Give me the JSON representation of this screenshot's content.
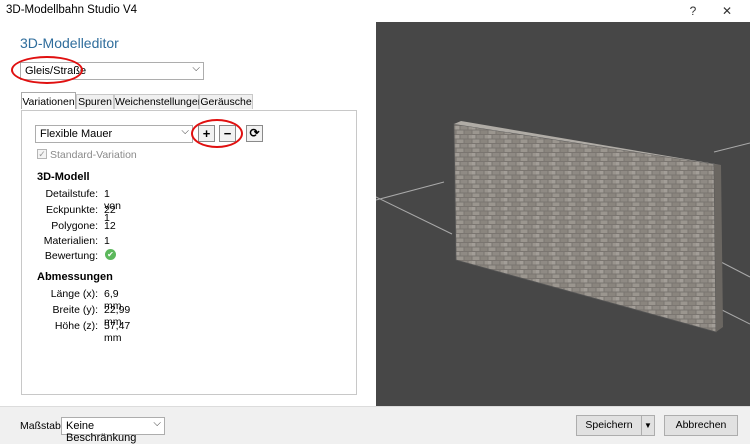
{
  "window": {
    "title": "3D-Modellbahn Studio V4",
    "help": "?",
    "close": "✕"
  },
  "editor": {
    "title": "3D-Modelleditor"
  },
  "type_select": {
    "value": "Gleis/Straße"
  },
  "tabs": [
    {
      "label": "Variationen",
      "active": true
    },
    {
      "label": "Spuren"
    },
    {
      "label": "Weichenstellungen"
    },
    {
      "label": "Geräusche"
    }
  ],
  "variation": {
    "value": "Flexible Mauer",
    "add": "+",
    "remove": "−",
    "refresh": "⟳"
  },
  "standard_variation": {
    "label": "Standard-Variation",
    "checked": true
  },
  "model": {
    "heading": "3D-Modell",
    "rows": [
      {
        "label": "Detailstufe:",
        "value": "1 von 1"
      },
      {
        "label": "Eckpunkte:",
        "value": "22"
      },
      {
        "label": "Polygone:",
        "value": "12"
      },
      {
        "label": "Materialien:",
        "value": "1"
      },
      {
        "label": "Bewertung:",
        "value": ""
      }
    ]
  },
  "dims": {
    "heading": "Abmessungen",
    "rows": [
      {
        "label": "Länge (x):",
        "value": "6,9 mm"
      },
      {
        "label": "Breite (y):",
        "value": "22,99 mm"
      },
      {
        "label": "Höhe (z):",
        "value": "57,47 mm"
      }
    ]
  },
  "footer": {
    "scale_label": "Maßstab:",
    "scale_value": "Keine Beschränkung",
    "save": "Speichern",
    "cancel": "Abbrechen"
  },
  "colors": {
    "accent": "#2f6d9c",
    "highlight": "#e01010",
    "viewport_bg": "#474747"
  }
}
